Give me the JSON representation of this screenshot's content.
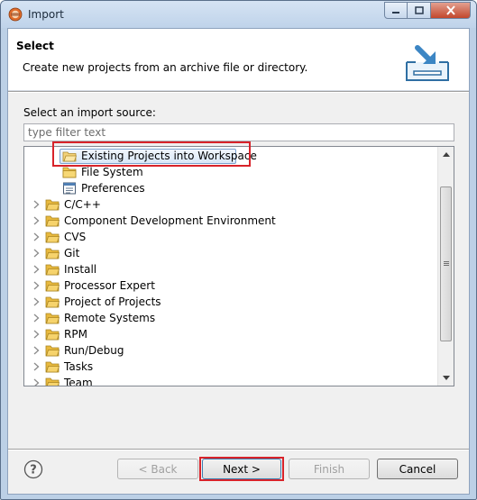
{
  "window": {
    "title": "Import"
  },
  "header": {
    "title": "Select",
    "description": "Create new projects from an archive file or directory."
  },
  "source": {
    "label": "Select an import source:",
    "filter_placeholder": "type filter text"
  },
  "tree": {
    "children": [
      {
        "label": "Existing Projects into Workspace",
        "icon": "project-import-icon",
        "selected": true
      },
      {
        "label": "File System",
        "icon": "folder-icon"
      },
      {
        "label": "Preferences",
        "icon": "preferences-icon"
      }
    ],
    "categories": [
      {
        "label": "C/C++"
      },
      {
        "label": "Component Development Environment"
      },
      {
        "label": "CVS"
      },
      {
        "label": "Git"
      },
      {
        "label": "Install"
      },
      {
        "label": "Processor Expert"
      },
      {
        "label": "Project of Projects"
      },
      {
        "label": "Remote Systems"
      },
      {
        "label": "RPM"
      },
      {
        "label": "Run/Debug"
      },
      {
        "label": "Tasks"
      },
      {
        "label": "Team"
      }
    ]
  },
  "buttons": {
    "back": "< Back",
    "next": "Next >",
    "finish": "Finish",
    "cancel": "Cancel"
  },
  "colors": {
    "highlight": "#d8232a",
    "selection": "#d9e8f8"
  }
}
